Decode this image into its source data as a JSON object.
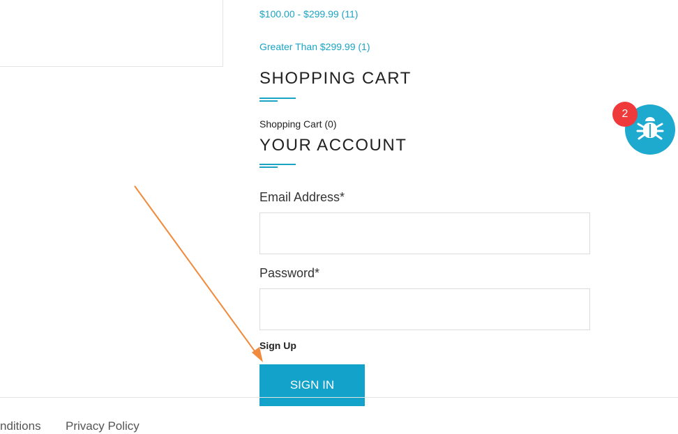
{
  "price_filters": [
    {
      "label": "$100.00 - $299.99 (11)"
    },
    {
      "label": "Greater Than $299.99 (1)"
    }
  ],
  "shopping_cart": {
    "title": "SHOPPING CART",
    "link_label": "Shopping Cart (0)"
  },
  "account": {
    "title": "YOUR ACCOUNT",
    "email_label": "Email Address*",
    "email_value": "",
    "password_label": "Password*",
    "password_value": "",
    "signup_label": "Sign Up",
    "signin_label": "SIGN IN"
  },
  "footer": {
    "links": [
      "nditions",
      "Privacy Policy"
    ]
  },
  "bug_widget": {
    "badge_count": "2",
    "icon": "bug-icon"
  },
  "colors": {
    "accent": "#1aa3c2",
    "button": "#13a2c9",
    "badge": "#ee3a3a",
    "annotation_arrow": "#f08a3c"
  }
}
